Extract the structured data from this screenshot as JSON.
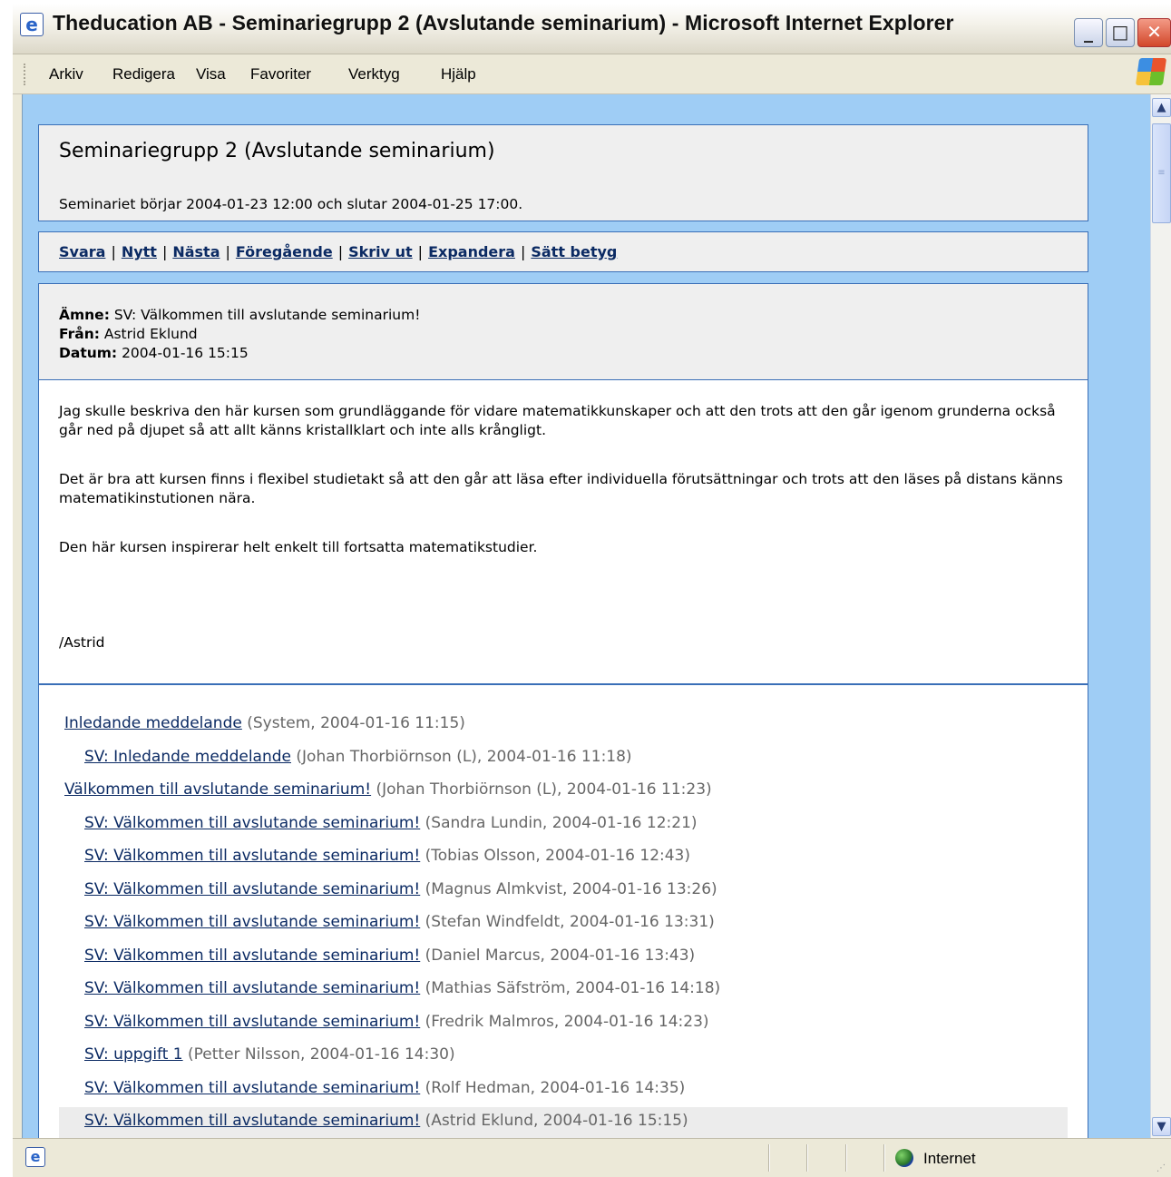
{
  "window": {
    "title": "Theducation AB - Seminariegrupp 2 (Avslutande seminarium) - Microsoft Internet Explorer"
  },
  "menu": [
    "Arkiv",
    "Redigera",
    "Visa",
    "Favoriter",
    "Verktyg",
    "Hjälp"
  ],
  "page": {
    "title": "Seminariegrupp 2 (Avslutande seminarium)",
    "subtitle": "Seminariet börjar 2004-01-23 12:00 och slutar 2004-01-25 17:00."
  },
  "nav": [
    "Svara",
    "Nytt",
    "Nästa",
    "Föregående",
    "Skriv ut",
    "Expandera",
    "Sätt betyg"
  ],
  "message": {
    "subject_label": "Ämne:",
    "subject": "SV: Välkommen till avslutande seminarium!",
    "from_label": "Från:",
    "from": "Astrid Eklund",
    "date_label": "Datum:",
    "date": "2004-01-16 15:15",
    "paragraphs": [
      "Jag skulle beskriva den här kursen som grundläggande för vidare matematikkunskaper och att den trots att den går igenom grunderna också går ned på djupet så att allt känns kristallklart och inte alls krångligt.",
      "Det är bra att kursen finns i flexibel studietakt så att den går att läsa efter individuella förutsättningar och trots att den läses på distans känns matematikinstutionen nära.",
      "Den här kursen inspirerar helt enkelt till fortsatta matematikstudier."
    ],
    "signature": "/Astrid"
  },
  "thread": [
    {
      "title": "Inledande meddelande",
      "info": "(System, 2004-01-16 11:15)",
      "level": 0
    },
    {
      "title": "SV: Inledande meddelande",
      "info": "(Johan Thorbiörnson (L), 2004-01-16 11:18)",
      "level": 1
    },
    {
      "title": "Välkommen till avslutande seminarium!",
      "info": "(Johan Thorbiörnson (L), 2004-01-16 11:23)",
      "level": 0
    },
    {
      "title": "SV: Välkommen till avslutande seminarium!",
      "info": "(Sandra Lundin, 2004-01-16 12:21)",
      "level": 1
    },
    {
      "title": "SV: Välkommen till avslutande seminarium!",
      "info": "(Tobias Olsson, 2004-01-16 12:43)",
      "level": 1
    },
    {
      "title": "SV: Välkommen till avslutande seminarium!",
      "info": "(Magnus Almkvist, 2004-01-16 13:26)",
      "level": 1
    },
    {
      "title": "SV: Välkommen till avslutande seminarium!",
      "info": "(Stefan Windfeldt, 2004-01-16 13:31)",
      "level": 1
    },
    {
      "title": "SV: Välkommen till avslutande seminarium!",
      "info": "(Daniel Marcus, 2004-01-16 13:43)",
      "level": 1
    },
    {
      "title": "SV: Välkommen till avslutande seminarium!",
      "info": "(Mathias Säfström, 2004-01-16 14:18)",
      "level": 1
    },
    {
      "title": "SV: Välkommen till avslutande seminarium!",
      "info": "(Fredrik Malmros, 2004-01-16 14:23)",
      "level": 1
    },
    {
      "title": "SV: uppgift 1",
      "info": "(Petter Nilsson, 2004-01-16 14:30)",
      "level": 1
    },
    {
      "title": "SV: Välkommen till avslutande seminarium!",
      "info": "(Rolf Hedman, 2004-01-16 14:35)",
      "level": 1
    },
    {
      "title": "SV: Välkommen till avslutande seminarium!",
      "info": "(Astrid Eklund, 2004-01-16 15:15)",
      "level": 1,
      "selected": true
    }
  ],
  "status": {
    "zone": "Internet"
  },
  "icons": {
    "title": "ie-icon",
    "status": "ie-page-icon",
    "zone": "globe-icon",
    "brand": "windows-logo-icon"
  }
}
